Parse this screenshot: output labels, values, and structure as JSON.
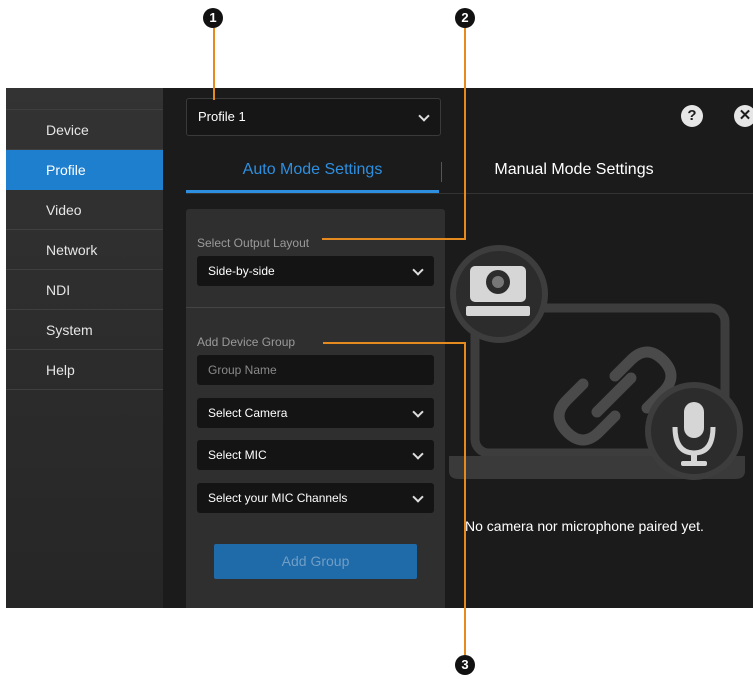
{
  "callouts": [
    "1",
    "2",
    "3"
  ],
  "sidebar": {
    "items": [
      {
        "label": "Device"
      },
      {
        "label": "Profile"
      },
      {
        "label": "Video"
      },
      {
        "label": "Network"
      },
      {
        "label": "NDI"
      },
      {
        "label": "System"
      },
      {
        "label": "Help"
      }
    ],
    "active": "Profile"
  },
  "header": {
    "profile_select": "Profile 1",
    "help_icon": "?",
    "close_icon": "✕"
  },
  "tabs": [
    {
      "label": "Auto Mode Settings",
      "active": true
    },
    {
      "label": "Manual Mode Settings",
      "active": false
    }
  ],
  "panel": {
    "output_layout_label": "Select Output Layout",
    "output_layout_value": "Side-by-side",
    "device_group_label": "Add Device Group",
    "group_name_placeholder": "Group Name",
    "camera_select": "Select Camera",
    "mic_select": "Select MIC",
    "mic_channels_select": "Select your MIC Channels",
    "add_group_button": "Add Group"
  },
  "illustration": {
    "icons": [
      "laptop-icon",
      "camera-icon",
      "link-icon",
      "microphone-icon"
    ],
    "message": "No camera nor microphone paired yet."
  },
  "colors": {
    "accent": "#1e7fcf",
    "tab_active": "#2e8fe0",
    "callout_line": "#e58a1f"
  }
}
